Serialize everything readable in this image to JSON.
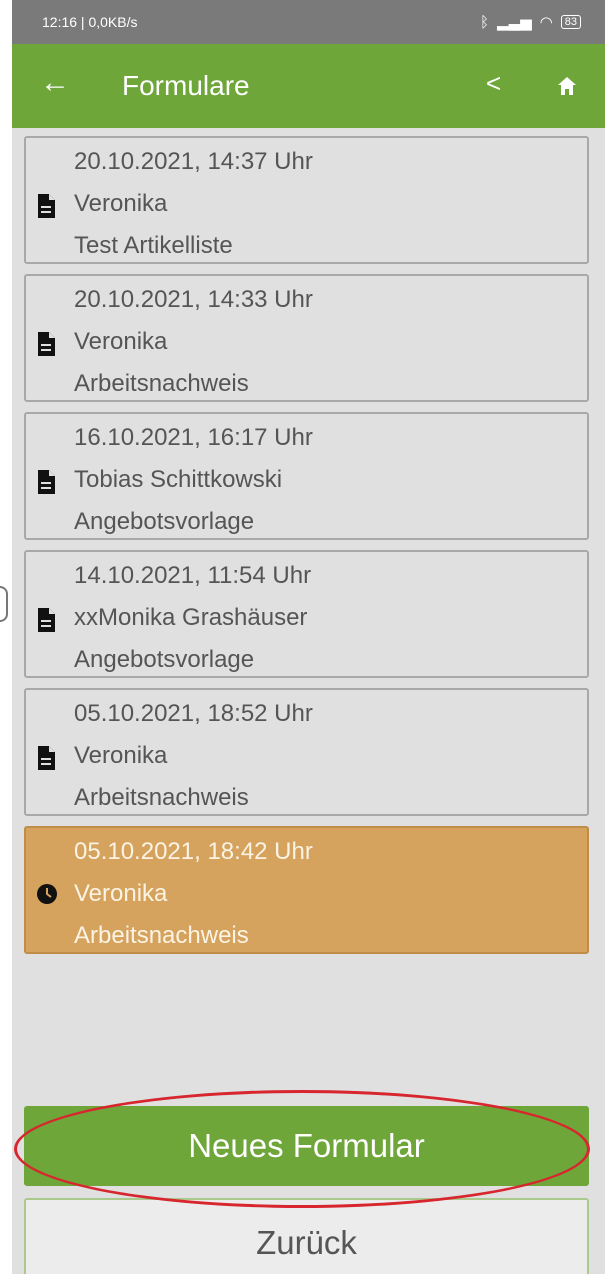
{
  "status_bar": {
    "left_text": "12:16 | 0,0KB/s",
    "right_icons": [
      "bluetooth-icon",
      "signal-icon",
      "wifi-icon",
      "battery-icon"
    ],
    "battery_level": "83"
  },
  "app_bar": {
    "title": "Formulare",
    "back_icon": "arrow-left-icon",
    "prev_label": "<",
    "home_icon": "home-icon"
  },
  "forms": [
    {
      "datetime": "20.10.2021, 14:37 Uhr",
      "person": "Veronika",
      "type": "Test Artikelliste",
      "icon": "document-icon",
      "active": false
    },
    {
      "datetime": "20.10.2021, 14:33 Uhr",
      "person": "Veronika",
      "type": "Arbeitsnachweis",
      "icon": "document-icon",
      "active": false
    },
    {
      "datetime": "16.10.2021, 16:17 Uhr",
      "person": "Tobias Schittkowski",
      "type": "Angebotsvorlage",
      "icon": "document-icon",
      "active": false
    },
    {
      "datetime": "14.10.2021, 11:54 Uhr",
      "person": "xxMonika Grashäuser",
      "type": "Angebotsvorlage",
      "icon": "document-icon",
      "active": false
    },
    {
      "datetime": "05.10.2021, 18:52 Uhr",
      "person": "Veronika",
      "type": "Arbeitsnachweis",
      "icon": "document-icon",
      "active": false
    },
    {
      "datetime": "05.10.2021, 18:42 Uhr",
      "person": "Veronika",
      "type": "Arbeitsnachweis",
      "icon": "clock-icon",
      "active": true
    }
  ],
  "buttons": {
    "new_form": "Neues Formular",
    "back": "Zurück"
  },
  "colors": {
    "primary_green": "#6ea63a",
    "active_item": "#d5a35e",
    "highlight_ellipse": "#d7262e"
  }
}
